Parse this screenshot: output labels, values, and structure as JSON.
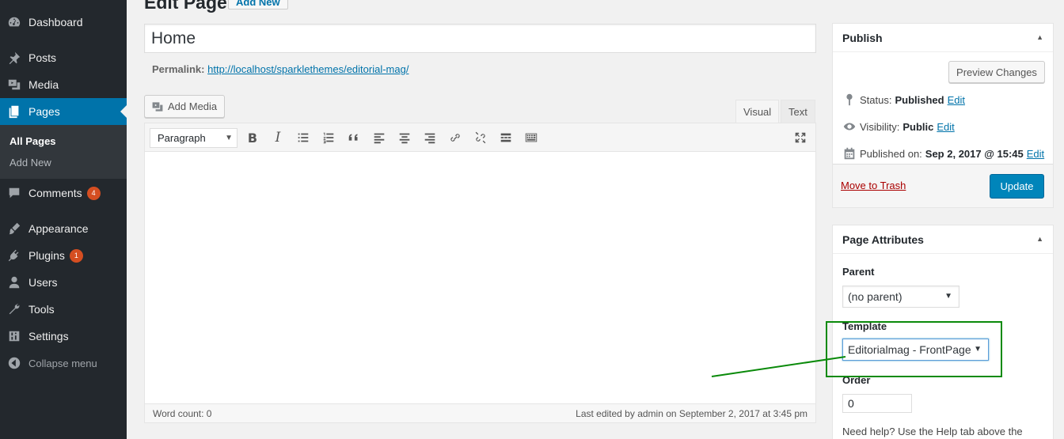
{
  "sidebar": {
    "items": [
      {
        "label": "Dashboard",
        "icon": "dashboard-icon"
      },
      {
        "label": "Posts",
        "icon": "pin-icon"
      },
      {
        "label": "Media",
        "icon": "media-icon"
      },
      {
        "label": "Pages",
        "icon": "pages-icon"
      },
      {
        "label": "Comments",
        "icon": "comment-icon",
        "badge": "4"
      },
      {
        "label": "Appearance",
        "icon": "brush-icon"
      },
      {
        "label": "Plugins",
        "icon": "plugin-icon",
        "badge": "1"
      },
      {
        "label": "Users",
        "icon": "user-icon"
      },
      {
        "label": "Tools",
        "icon": "wrench-icon"
      },
      {
        "label": "Settings",
        "icon": "settings-icon"
      }
    ],
    "submenu": [
      "All Pages",
      "Add New"
    ],
    "collapse_label": "Collapse menu"
  },
  "header": {
    "title": "Edit Page",
    "add_new": "Add New"
  },
  "editor": {
    "title": "Home",
    "permalink_label": "Permalink:",
    "permalink_url": "http://localhost/sparklethemes/editorial-mag/",
    "add_media": "Add Media",
    "tab_visual": "Visual",
    "tab_text": "Text",
    "format": "Paragraph",
    "word_count": "Word count: 0",
    "last_edited": "Last edited by admin on September 2, 2017 at 3:45 pm"
  },
  "publish": {
    "title": "Publish",
    "preview": "Preview Changes",
    "status_label": "Status:",
    "status_value": "Published",
    "visibility_label": "Visibility:",
    "visibility_value": "Public",
    "published_label": "Published on:",
    "published_value": "Sep 2, 2017 @ 15:45",
    "edit": "Edit",
    "trash": "Move to Trash",
    "update": "Update"
  },
  "attributes": {
    "title": "Page Attributes",
    "parent_label": "Parent",
    "parent_value": "(no parent)",
    "template_label": "Template",
    "template_value": "Editorialmag - FrontPage",
    "order_label": "Order",
    "order_value": "0",
    "help": "Need help? Use the Help tab above the"
  },
  "colors": {
    "sidebar": "#23282d",
    "accent": "#0073aa",
    "annotation": "#0a8a0a"
  }
}
